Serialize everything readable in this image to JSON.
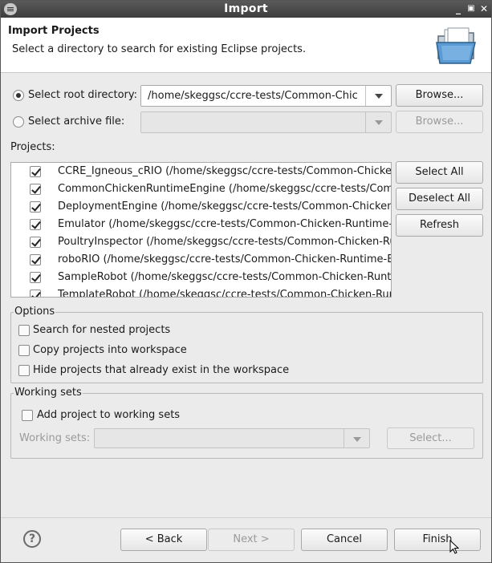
{
  "window": {
    "title": "Import"
  },
  "header": {
    "title": "Import Projects",
    "description": "Select a directory to search for existing Eclipse projects."
  },
  "source": {
    "root_label": "Select root directory:",
    "root_value": "/home/skeggsc/ccre-tests/Common-Chic",
    "root_browse": "Browse...",
    "archive_label": "Select archive file:",
    "archive_value": "",
    "archive_browse": "Browse..."
  },
  "projects": {
    "label": "Projects:",
    "items": [
      {
        "text": "CCRE_Igneous_cRIO (/home/skeggsc/ccre-tests/Common-Chicken-Runtime-Engine/CCRE_Igneous_cRIO)",
        "checked": true
      },
      {
        "text": "CommonChickenRuntimeEngine (/home/skeggsc/ccre-tests/Common-Chicken-Runtime-Engine/CommonChickenRuntimeEngine)",
        "checked": true
      },
      {
        "text": "DeploymentEngine (/home/skeggsc/ccre-tests/Common-Chicken-Runtime-Engine/DeploymentEngine)",
        "checked": true
      },
      {
        "text": "Emulator (/home/skeggsc/ccre-tests/Common-Chicken-Runtime-Engine/Emulator)",
        "checked": true
      },
      {
        "text": "PoultryInspector (/home/skeggsc/ccre-tests/Common-Chicken-Runtime-Engine/PoultryInspector)",
        "checked": true
      },
      {
        "text": "roboRIO (/home/skeggsc/ccre-tests/Common-Chicken-Runtime-Engine/roboRIO)",
        "checked": true
      },
      {
        "text": "SampleRobot (/home/skeggsc/ccre-tests/Common-Chicken-Runtime-Engine/SampleRobot)",
        "checked": true
      },
      {
        "text": "TemplateRobot (/home/skeggsc/ccre-tests/Common-Chicken-Runtime-Engine/TemplateRobot)",
        "checked": true
      }
    ],
    "select_all": "Select All",
    "deselect_all": "Deselect All",
    "refresh": "Refresh"
  },
  "options": {
    "legend": "Options",
    "nested": "Search for nested projects",
    "copy": "Copy projects into workspace",
    "hide": "Hide projects that already exist in the workspace"
  },
  "working_sets": {
    "legend": "Working sets",
    "add": "Add project to working sets",
    "label": "Working sets:",
    "value": "",
    "select": "Select..."
  },
  "footer": {
    "help": "?",
    "back": "< Back",
    "next": "Next >",
    "cancel": "Cancel",
    "finish": "Finish"
  }
}
